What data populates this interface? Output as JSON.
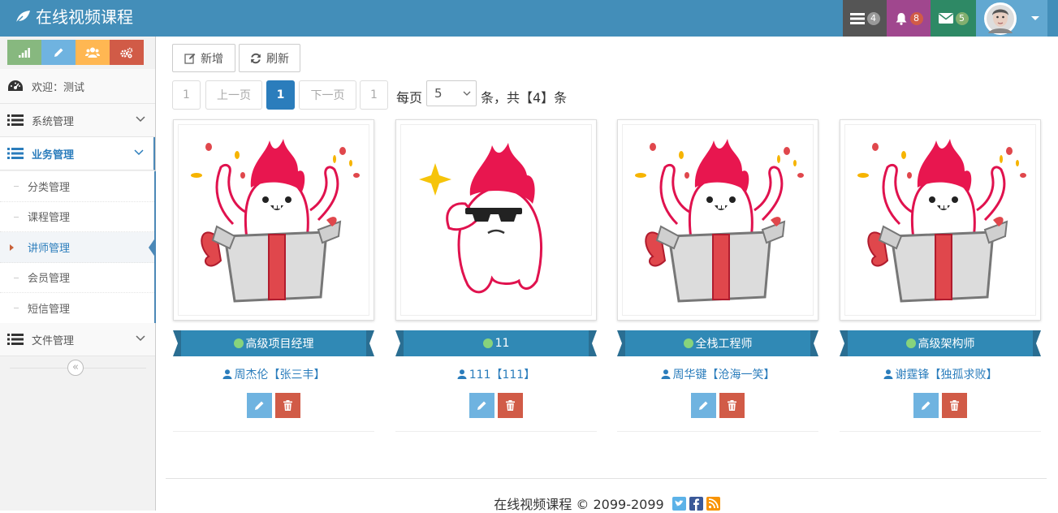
{
  "app": {
    "title": "在线视频课程"
  },
  "navbar": {
    "tasks_count": "4",
    "notifications_count": "8",
    "messages_count": "5",
    "colors": {
      "bg": "#438eb9",
      "tasks": "#555555",
      "notifications": "#a0478e",
      "messages": "#2e8965",
      "user": "#62a8d1"
    }
  },
  "sidebar": {
    "welcome": "欢迎：测试",
    "menus": [
      {
        "label": "系统管理"
      },
      {
        "label": "业务管理"
      },
      {
        "label": "文件管理"
      }
    ],
    "submenu": [
      {
        "label": "分类管理"
      },
      {
        "label": "课程管理"
      },
      {
        "label": "讲师管理"
      },
      {
        "label": "会员管理"
      },
      {
        "label": "短信管理"
      }
    ],
    "collapse_symbol": "«"
  },
  "toolbar": {
    "add_label": "新增",
    "refresh_label": "刷新"
  },
  "pager": {
    "first": "1",
    "prev": "上一页",
    "current": "1",
    "next": "下一页",
    "last": "1",
    "per_page_label": "每页",
    "per_page_value": "5",
    "total_text": "条，共【4】条"
  },
  "teachers": [
    {
      "title": "高级项目经理",
      "name": "周杰伦【张三丰】",
      "image": "celebration"
    },
    {
      "title": "11",
      "name": "111【111】",
      "image": "cool"
    },
    {
      "title": "全栈工程师",
      "name": "周华键【沧海一笑】",
      "image": "celebration"
    },
    {
      "title": "高级架构师",
      "name": "谢霆锋【独孤求败】",
      "image": "celebration"
    }
  ],
  "footer": {
    "text": "在线视频课程 © 2099-2099"
  }
}
